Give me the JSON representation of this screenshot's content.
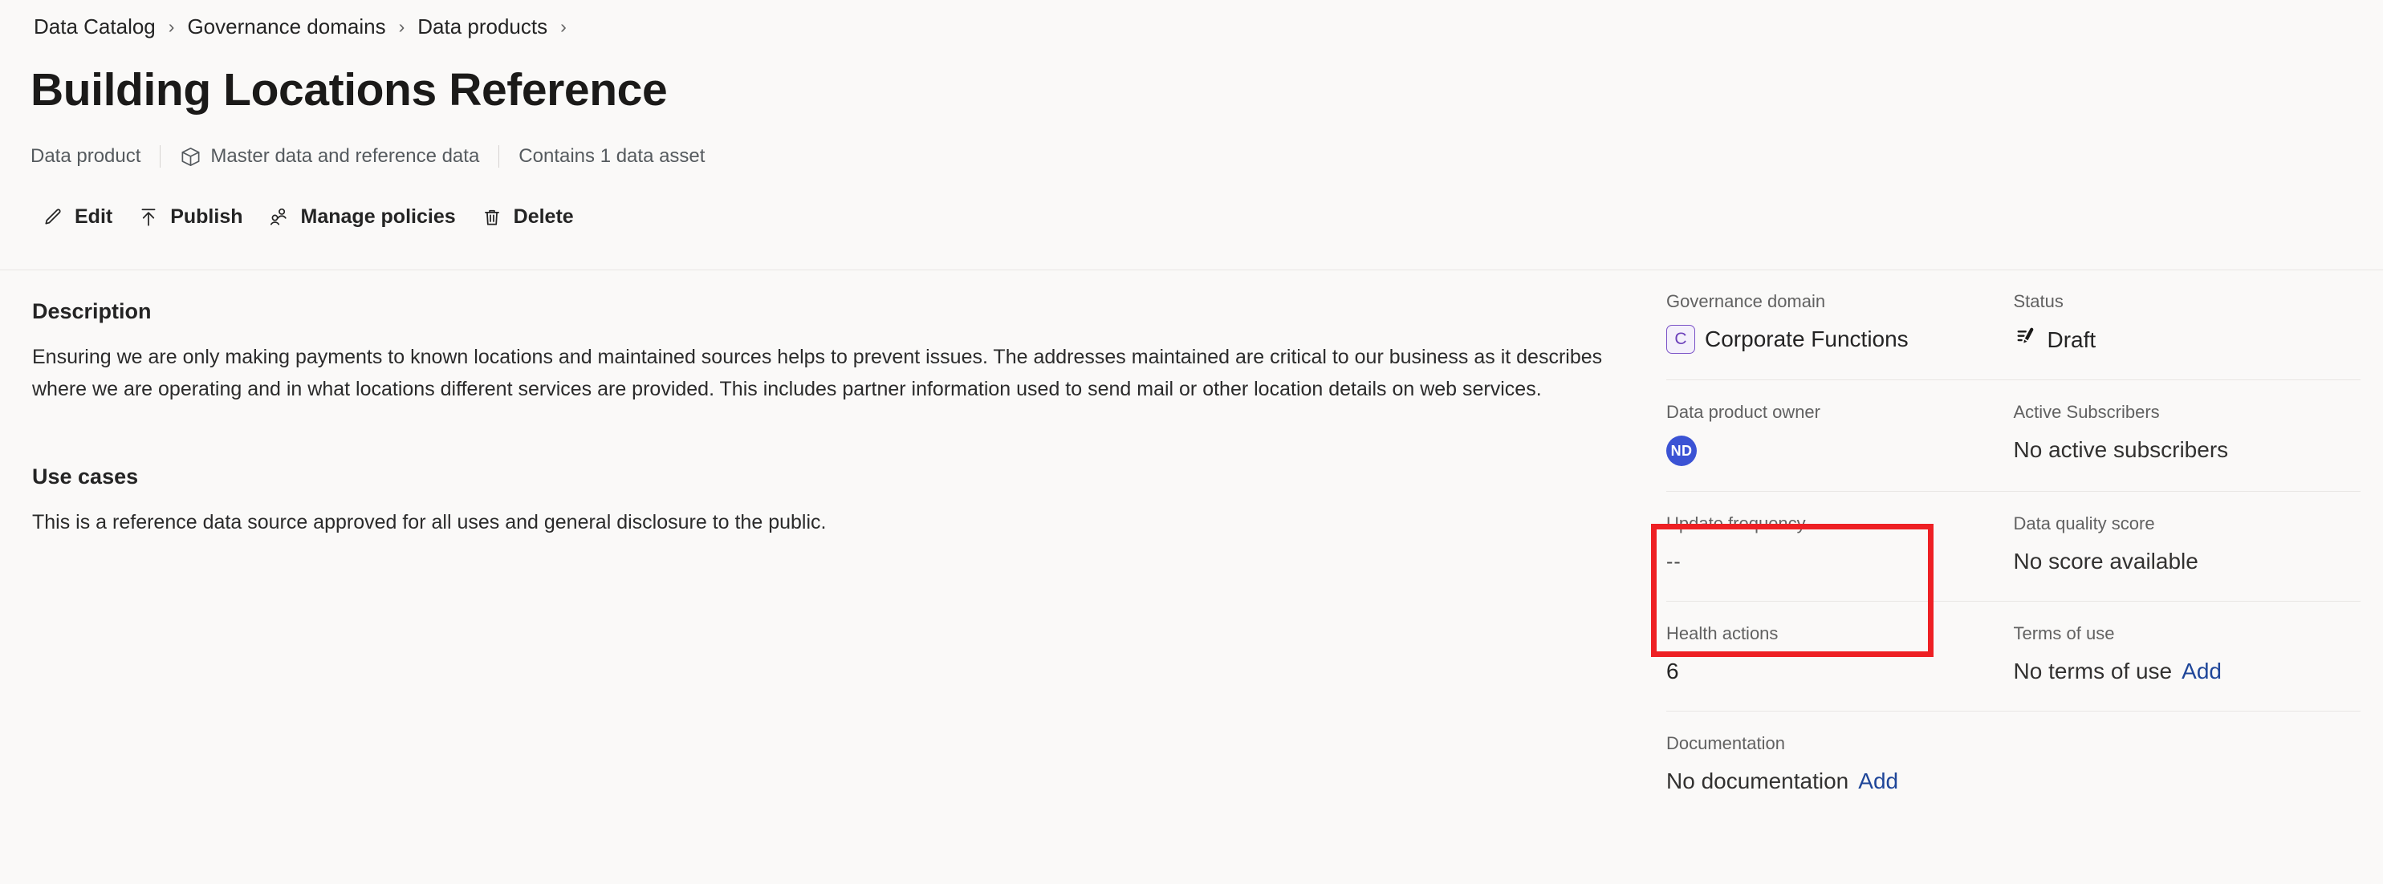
{
  "breadcrumb": {
    "separator": "›",
    "items": [
      {
        "label": "Data Catalog"
      },
      {
        "label": "Governance domains"
      },
      {
        "label": "Data products"
      }
    ]
  },
  "header": {
    "title": "Building Locations Reference",
    "meta": [
      {
        "label": "Data product",
        "icon": ""
      },
      {
        "label": "Master data and reference data",
        "icon": "cube-icon"
      },
      {
        "label": "Contains 1 data asset",
        "icon": ""
      }
    ]
  },
  "toolbar": {
    "buttons": [
      {
        "label": "Edit",
        "icon": "pencil-icon"
      },
      {
        "label": "Publish",
        "icon": "publish-upload-icon"
      },
      {
        "label": "Manage policies",
        "icon": "people-icon"
      },
      {
        "label": "Delete",
        "icon": "trash-icon"
      }
    ]
  },
  "main": {
    "description_heading": "Description",
    "description_body": "Ensuring we are only making payments to known locations and maintained sources helps to prevent issues.  The addresses maintained are critical to our business as it describes where we are operating and in what locations different services are provided.  This includes partner information used to send mail or other location details on web services.",
    "use_cases_heading": "Use cases",
    "use_cases_body": "This is a reference data source approved for all uses and general disclosure to the public."
  },
  "details": {
    "governance_domain": {
      "label": "Governance domain",
      "badge_initial": "C",
      "value": "Corporate Functions"
    },
    "status": {
      "label": "Status",
      "value": "Draft",
      "icon": "draft-pen-icon"
    },
    "owner": {
      "label": "Data product owner",
      "avatar_initials": "ND"
    },
    "active_subscribers": {
      "label": "Active Subscribers",
      "value": "No active subscribers"
    },
    "update_frequency": {
      "label": "Update frequency",
      "value": "--"
    },
    "data_quality_score": {
      "label": "Data quality score",
      "value": "No score available"
    },
    "health_actions": {
      "label": "Health actions",
      "value": "6"
    },
    "terms_of_use": {
      "label": "Terms of use",
      "value": "No terms of use",
      "action": "Add"
    },
    "documentation": {
      "label": "Documentation",
      "value": "No documentation",
      "action": "Add"
    }
  },
  "annotation": {
    "highlight_color": "#ee2024",
    "highlight_target": "update-frequency-field"
  }
}
